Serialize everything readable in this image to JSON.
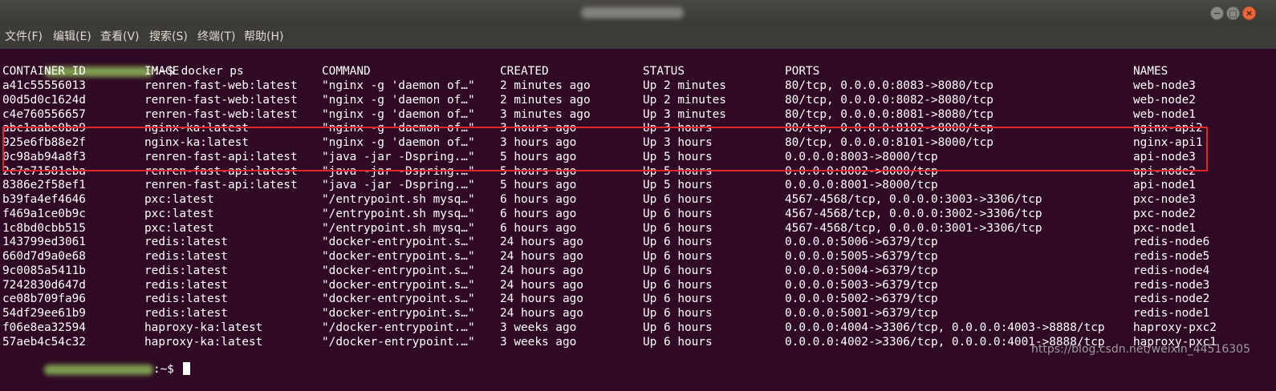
{
  "window": {
    "buttons": [
      "−",
      "□",
      "×"
    ]
  },
  "menubar": [
    "文件(F)",
    "编辑(E)",
    "查看(V)",
    "搜索(S)",
    "终端(T)",
    "帮助(H)"
  ],
  "terminal": {
    "prompt_suffix": ":~$ ",
    "command": "docker ps",
    "prompt_end": ":~$ ",
    "headers": [
      "CONTAINER ID",
      "IMAGE",
      "COMMAND",
      "CREATED",
      "STATUS",
      "PORTS",
      "NAMES"
    ],
    "rows": [
      [
        "a41c55556013",
        "renren-fast-web:latest",
        "\"nginx -g 'daemon of…\"",
        "2 minutes ago",
        "Up 2 minutes",
        "80/tcp, 0.0.0.0:8083->8080/tcp",
        "web-node3"
      ],
      [
        "00d5d0c1624d",
        "renren-fast-web:latest",
        "\"nginx -g 'daemon of…\"",
        "2 minutes ago",
        "Up 2 minutes",
        "80/tcp, 0.0.0.0:8082->8080/tcp",
        "web-node2"
      ],
      [
        "c4e760556657",
        "renren-fast-web:latest",
        "\"nginx -g 'daemon of…\"",
        "3 minutes ago",
        "Up 3 minutes",
        "80/tcp, 0.0.0.0:8081->8080/tcp",
        "web-node1"
      ],
      [
        "abc1aabe0ba9",
        "nginx-ka:latest",
        "\"nginx -g 'daemon of…\"",
        "3 hours ago",
        "Up 3 hours",
        "80/tcp, 0.0.0.0:8102->8000/tcp",
        "nginx-api2"
      ],
      [
        "925e6fb88e2f",
        "nginx-ka:latest",
        "\"nginx -g 'daemon of…\"",
        "3 hours ago",
        "Up 3 hours",
        "80/tcp, 0.0.0.0:8101->8000/tcp",
        "nginx-api1"
      ],
      [
        "0c98ab94a8f3",
        "renren-fast-api:latest",
        "\"java -jar -Dspring.…\"",
        "5 hours ago",
        "Up 5 hours",
        "0.0.0.0:8003->8000/tcp",
        "api-node3"
      ],
      [
        "2c7e71581eba",
        "renren-fast-api:latest",
        "\"java -jar -Dspring.…\"",
        "5 hours ago",
        "Up 5 hours",
        "0.0.0.0:8002->8000/tcp",
        "api-node2"
      ],
      [
        "8386e2f58ef1",
        "renren-fast-api:latest",
        "\"java -jar -Dspring.…\"",
        "5 hours ago",
        "Up 5 hours",
        "0.0.0.0:8001->8000/tcp",
        "api-node1"
      ],
      [
        "b39fa4ef4646",
        "pxc:latest",
        "\"/entrypoint.sh mysq…\"",
        "6 hours ago",
        "Up 6 hours",
        "4567-4568/tcp, 0.0.0.0:3003->3306/tcp",
        "pxc-node3"
      ],
      [
        "f469a1ce0b9c",
        "pxc:latest",
        "\"/entrypoint.sh mysq…\"",
        "6 hours ago",
        "Up 6 hours",
        "4567-4568/tcp, 0.0.0.0:3002->3306/tcp",
        "pxc-node2"
      ],
      [
        "1c8bd0cbb515",
        "pxc:latest",
        "\"/entrypoint.sh mysq…\"",
        "6 hours ago",
        "Up 6 hours",
        "4567-4568/tcp, 0.0.0.0:3001->3306/tcp",
        "pxc-node1"
      ],
      [
        "143799ed3061",
        "redis:latest",
        "\"docker-entrypoint.s…\"",
        "24 hours ago",
        "Up 6 hours",
        "0.0.0.0:5006->6379/tcp",
        "redis-node6"
      ],
      [
        "660d7d9a0e68",
        "redis:latest",
        "\"docker-entrypoint.s…\"",
        "24 hours ago",
        "Up 6 hours",
        "0.0.0.0:5005->6379/tcp",
        "redis-node5"
      ],
      [
        "9c0085a5411b",
        "redis:latest",
        "\"docker-entrypoint.s…\"",
        "24 hours ago",
        "Up 6 hours",
        "0.0.0.0:5004->6379/tcp",
        "redis-node4"
      ],
      [
        "7242830d647d",
        "redis:latest",
        "\"docker-entrypoint.s…\"",
        "24 hours ago",
        "Up 6 hours",
        "0.0.0.0:5003->6379/tcp",
        "redis-node3"
      ],
      [
        "ce08b709fa96",
        "redis:latest",
        "\"docker-entrypoint.s…\"",
        "24 hours ago",
        "Up 6 hours",
        "0.0.0.0:5002->6379/tcp",
        "redis-node2"
      ],
      [
        "54df29ee61b9",
        "redis:latest",
        "\"docker-entrypoint.s…\"",
        "24 hours ago",
        "Up 6 hours",
        "0.0.0.0:5001->6379/tcp",
        "redis-node1"
      ],
      [
        "f06e8ea32594",
        "haproxy-ka:latest",
        "\"/docker-entrypoint.…\"",
        "3 weeks ago",
        "Up 6 hours",
        "0.0.0.0:4004->3306/tcp, 0.0.0.0:4003->8888/tcp",
        "haproxy-pxc2"
      ],
      [
        "57aeb4c54c32",
        "haproxy-ka:latest",
        "\"/docker-entrypoint.…\"",
        "3 weeks ago",
        "Up 6 hours",
        "0.0.0.0:4002->3306/tcp, 0.0.0.0:4001->8888/tcp",
        "haproxy-pxc1"
      ]
    ]
  },
  "watermark": "https://blog.csdn.net/weixin_44516305",
  "colors": {
    "terminal_bg": "#300a24",
    "text": "#ffffff",
    "prompt_user": "#8ae234",
    "prompt_path": "#729fcf",
    "highlight_border": "#e0262a"
  }
}
